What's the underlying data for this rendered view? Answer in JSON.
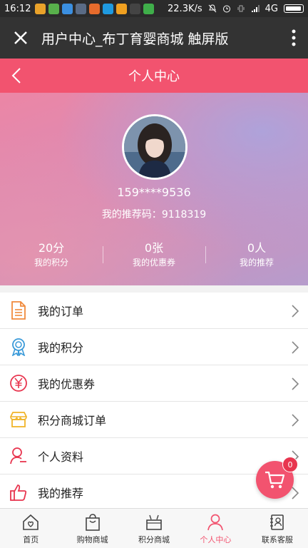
{
  "status_bar": {
    "time": "16:12",
    "network_speed": "22.3K/s",
    "network_type": "4G"
  },
  "browser": {
    "title": "用户中心_布丁育婴商城 触屏版",
    "close_icon": "close-icon",
    "more_icon": "more-vertical-icon"
  },
  "header": {
    "title": "个人中心",
    "back_icon": "chevron-left-icon"
  },
  "profile": {
    "phone": "159****9536",
    "referral_label": "我的推荐码：",
    "referral_code": "9118319",
    "stats": [
      {
        "value": "20分",
        "label": "我的积分"
      },
      {
        "value": "0张",
        "label": "我的优惠券"
      },
      {
        "value": "0人",
        "label": "我的推荐"
      }
    ]
  },
  "menu": [
    {
      "label": "我的订单",
      "icon": "order-document-icon",
      "color": "#f08a3c"
    },
    {
      "label": "我的积分",
      "icon": "medal-icon",
      "color": "#3a9ad9"
    },
    {
      "label": "我的优惠券",
      "icon": "yen-coupon-icon",
      "color": "#e8354f"
    },
    {
      "label": "积分商城订单",
      "icon": "store-icon",
      "color": "#f0b429"
    },
    {
      "label": "个人资料",
      "icon": "user-profile-icon",
      "color": "#e8354f"
    },
    {
      "label": "我的推荐",
      "icon": "thumbs-up-icon",
      "color": "#e8354f"
    }
  ],
  "cart": {
    "badge": "0"
  },
  "tabbar": [
    {
      "label": "首页",
      "icon": "home-icon",
      "active": false
    },
    {
      "label": "购物商城",
      "icon": "shopping-bag-icon",
      "active": false
    },
    {
      "label": "积分商城",
      "icon": "points-store-icon",
      "active": false
    },
    {
      "label": "个人中心",
      "icon": "user-icon",
      "active": true
    },
    {
      "label": "联系客服",
      "icon": "contact-book-icon",
      "active": false
    }
  ],
  "colors": {
    "accent": "#f2536f",
    "browser_bar": "#333333",
    "status_bar": "#2b2b2b"
  }
}
